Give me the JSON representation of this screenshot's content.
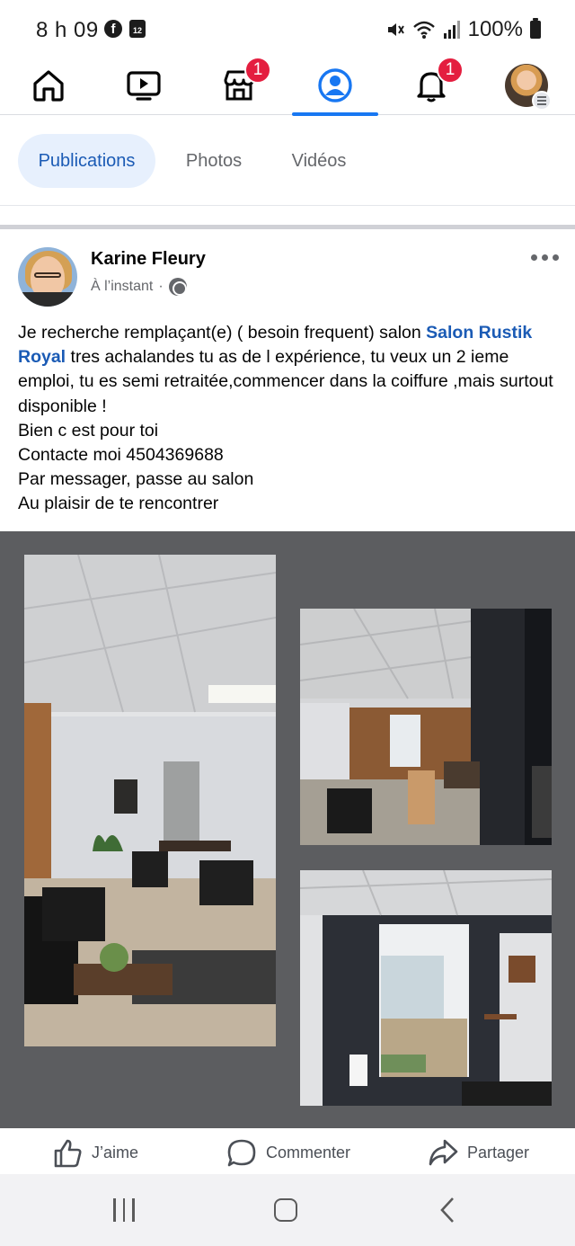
{
  "status_bar": {
    "time": "8 h 09",
    "calendar_day": "12",
    "battery": "100%",
    "icons": [
      "facebook-icon",
      "calendar-icon",
      "mute-icon",
      "wifi-icon",
      "signal-icon",
      "battery-icon"
    ]
  },
  "top_nav": {
    "items": [
      {
        "name": "home-icon"
      },
      {
        "name": "video-icon"
      },
      {
        "name": "marketplace-icon",
        "badge": "1"
      },
      {
        "name": "profile-icon",
        "active": true
      },
      {
        "name": "notifications-icon",
        "badge": "1"
      },
      {
        "name": "menu-profile-thumbnail"
      }
    ]
  },
  "tabs": [
    {
      "label": "Publications",
      "active": true
    },
    {
      "label": "Photos"
    },
    {
      "label": "Vidéos"
    }
  ],
  "post": {
    "author": "Karine Fleury",
    "timestamp": "À l’instant",
    "separator": "·",
    "text_before_link": "Je recherche remplaçant(e) ( besoin frequent) salon ",
    "link_text": "Salon Rustik Royal",
    "text_after_link": " tres achalandes tu as de l expérience, tu veux un 2 ieme emploi, tu es semi retraitée,commencer dans la coiffure ,mais surtout disponible !",
    "lines": [
      "Bien c est pour toi",
      "Contacte moi 4504369688",
      "Par messager, passe au salon",
      "Au plaisir de te rencontrer"
    ]
  },
  "actions": {
    "like": "J’aime",
    "comment": "Commenter",
    "share": "Partager"
  },
  "colors": {
    "accent": "#1877f2",
    "link": "#1b5bb5",
    "badge": "#e41e3f",
    "gallery_bg": "#5c5d60"
  }
}
